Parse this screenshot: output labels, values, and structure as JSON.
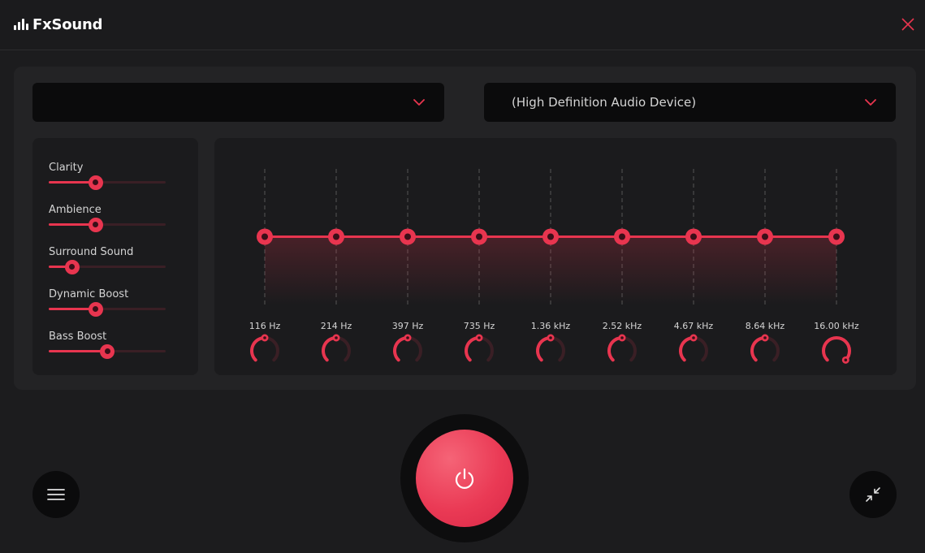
{
  "app": {
    "title": "FxSound"
  },
  "colors": {
    "accent": "#e8354f",
    "track": "#3a1f25",
    "background": "#1c1c1e",
    "panel": "#232325",
    "card": "#1b1b1d"
  },
  "presets": {
    "selected": ""
  },
  "output_device": {
    "selected": "(High Definition Audio Device)"
  },
  "effects": [
    {
      "label": "Clarity",
      "level": 0.4
    },
    {
      "label": "Ambience",
      "level": 0.4
    },
    {
      "label": "Surround Sound",
      "level": 0.2
    },
    {
      "label": "Dynamic Boost",
      "level": 0.4
    },
    {
      "label": "Bass Boost",
      "level": 0.5
    }
  ],
  "equalizer": {
    "bands": [
      {
        "label": "116 Hz",
        "level": 0.5
      },
      {
        "label": "214 Hz",
        "level": 0.5
      },
      {
        "label": "397 Hz",
        "level": 0.5
      },
      {
        "label": "735 Hz",
        "level": 0.5
      },
      {
        "label": "1.36 kHz",
        "level": 0.5
      },
      {
        "label": "2.52 kHz",
        "level": 0.5
      },
      {
        "label": "4.67 kHz",
        "level": 0.5
      },
      {
        "label": "8.64 kHz",
        "level": 0.5
      },
      {
        "label": "16.00 kHz",
        "level": 0.5
      }
    ],
    "knobs": [
      0.5,
      0.5,
      0.5,
      0.5,
      0.5,
      0.5,
      0.5,
      0.5,
      1.0
    ]
  },
  "icons": {
    "menu": "hamburger-menu-icon",
    "power": "power-icon",
    "minimize": "compact-view-icon",
    "close": "close-icon",
    "dropdown": "chevron-down-icon"
  }
}
